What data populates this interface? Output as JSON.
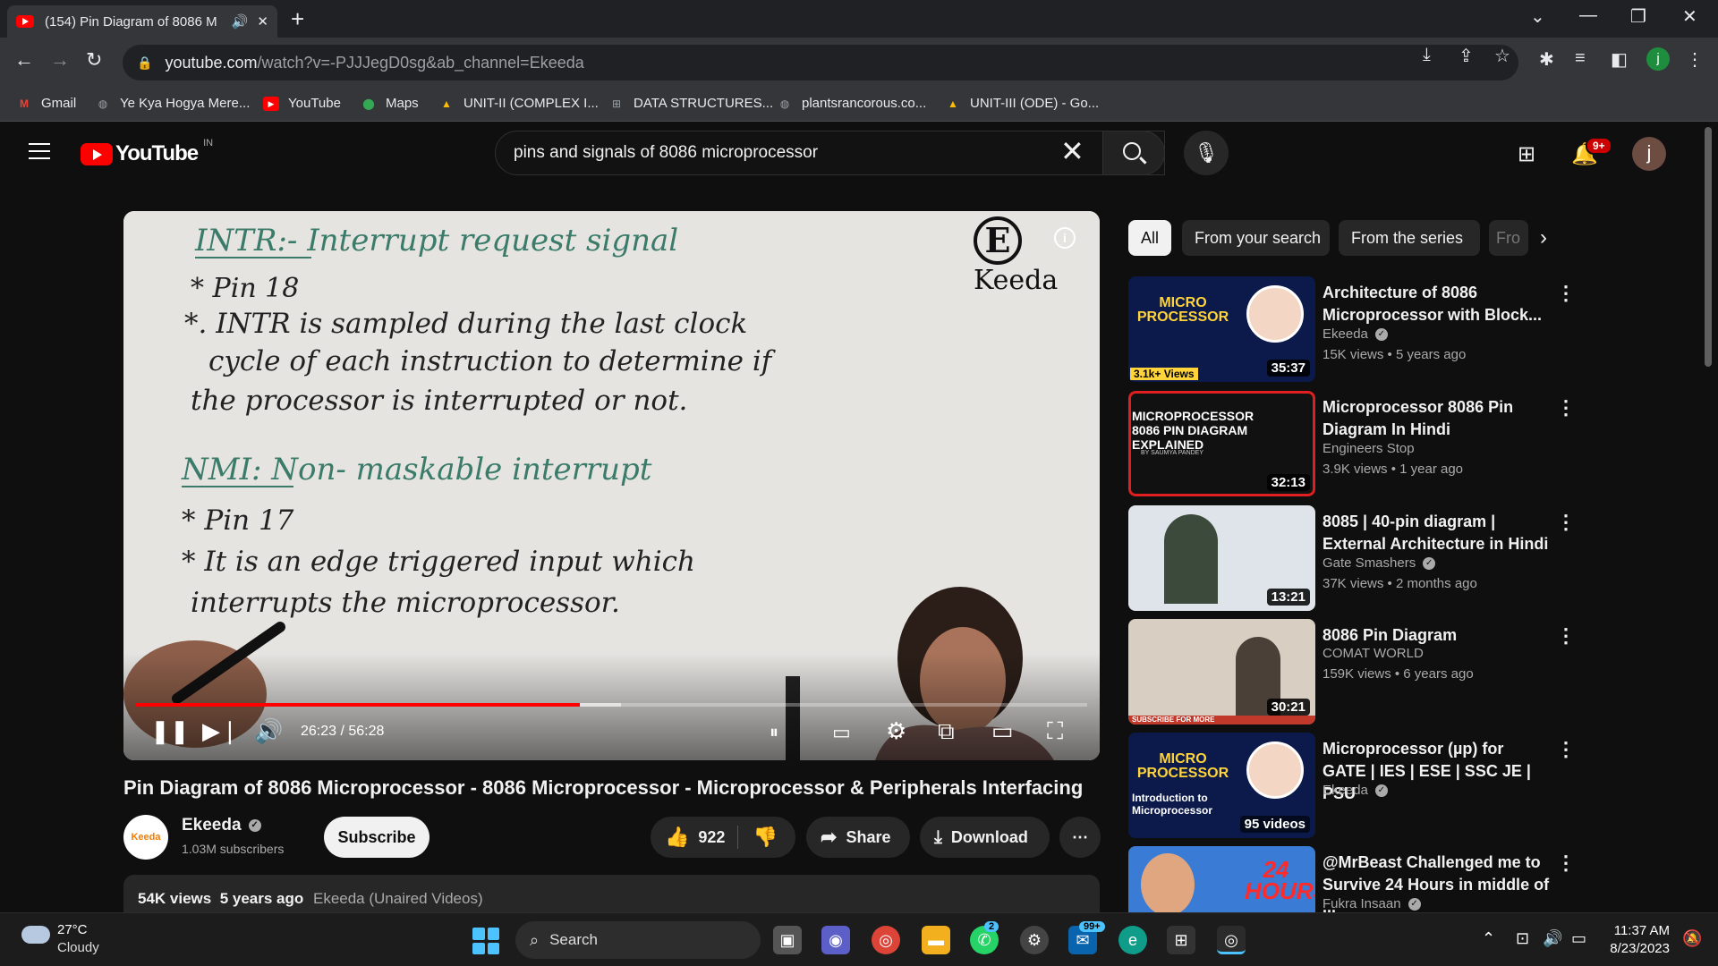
{
  "browser": {
    "tab_title": "(154) Pin Diagram of 8086 M",
    "url_domain": "youtube.com",
    "url_path": "/watch?v=-PJJJegD0sg&ab_channel=Ekeeda",
    "bookmarks": [
      {
        "label": "Gmail",
        "icon": "gmail-icon",
        "color": "#ea4335"
      },
      {
        "label": "Ye Kya Hogya Mere...",
        "icon": "globe-icon",
        "color": "#9aa0a6"
      },
      {
        "label": "YouTube",
        "icon": "youtube-icon",
        "color": "#ff0000"
      },
      {
        "label": "Maps",
        "icon": "maps-icon",
        "color": "#34a853"
      },
      {
        "label": "UNIT-II (COMPLEX I...",
        "icon": "drive-icon",
        "color": "#fbbc04"
      },
      {
        "label": "DATA STRUCTURES...",
        "icon": "cart-icon",
        "color": "#9aa0a6"
      },
      {
        "label": "plantsrancorous.co...",
        "icon": "globe-icon",
        "color": "#9aa0a6"
      },
      {
        "label": "UNIT-III (ODE) - Go...",
        "icon": "drive-icon",
        "color": "#fbbc04"
      }
    ]
  },
  "youtube": {
    "logo_text": "YouTube",
    "country_code": "IN",
    "search_query": "pins and signals of 8086 microprocessor",
    "notif_count": "9+",
    "avatar_letter": "j"
  },
  "player": {
    "board_lines": [
      "INTR:- Interrupt request signal",
      "* Pin 18",
      "*. INTR is sampled during the last clock",
      "cycle of each instruction to determine if",
      "the processor is interrupted or not.",
      "NMI: Non- maskable interrupt",
      "* Pin 17",
      "* It is an edge triggered input which",
      "interrupts the microprocessor."
    ],
    "watermark": "Keeda",
    "current_time": "26:23",
    "duration": "56:28",
    "time_display": "26:23 / 56:28",
    "progress_fraction": 0.467,
    "buffered_fraction": 0.51
  },
  "video": {
    "title": "Pin Diagram of 8086 Microprocessor - 8086 Microprocessor - Microprocessor & Peripherals Interfacing",
    "channel_name": "Ekeeda",
    "channel_avatar_text": "Keeda",
    "subscribers": "1.03M subscribers",
    "subscribe_label": "Subscribe",
    "likes": "922",
    "share_label": "Share",
    "download_label": "Download",
    "views": "54K views",
    "age": "5 years ago",
    "series": "Ekeeda (Unaired Videos)"
  },
  "chips": [
    "All",
    "From your search",
    "From the series",
    "Fro"
  ],
  "recommendations": [
    {
      "title": "Architecture of 8086 Microprocessor with Block...",
      "channel": "Ekeeda",
      "verified": true,
      "meta": "15K views  • 5 years ago",
      "duration": "35:37",
      "thumb_text": "MICRO PROCESSOR",
      "thumb_sub": "3.1k+ Views",
      "thumb_color": "#0b1a4a"
    },
    {
      "title": "Microprocessor 8086 Pin Diagram In Hindi",
      "channel": "Engineers Stop",
      "verified": false,
      "meta": "3.9K views  • 1 year ago",
      "duration": "32:13",
      "thumb_text": "MICROPROCESSOR 8086 PIN DIAGRAM EXPLAINED",
      "thumb_sub": "BY SAUMYA PANDEY",
      "thumb_color": "#111111"
    },
    {
      "title": "8085 | 40-pin diagram | External Architecture in Hindi",
      "channel": "Gate Smashers",
      "verified": true,
      "meta": "37K views  • 2 months ago",
      "duration": "13:21",
      "thumb_text": "",
      "thumb_sub": "",
      "thumb_color": "#dfe4ea"
    },
    {
      "title": "8086 Pin Diagram",
      "channel": "COMAT WORLD",
      "verified": false,
      "meta": "159K views  • 6 years ago",
      "duration": "30:21",
      "thumb_text": "",
      "thumb_sub": "SUBSCRIBE FOR MORE",
      "thumb_color": "#d8cfc2"
    },
    {
      "title": "Microprocessor (µp) for GATE | IES | ESE | SSC JE | PSU",
      "channel": "Ekeeda",
      "verified": true,
      "meta": "",
      "duration": "95 videos",
      "thumb_text": "MICRO PROCESSOR",
      "thumb_sub": "Introduction to Microprocessor",
      "thumb_color": "#0b1a4a"
    },
    {
      "title": "@MrBeast Challenged me to Survive 24 Hours in middle of ...",
      "channel": "Fukra Insaan",
      "verified": true,
      "meta": "",
      "duration": "",
      "thumb_text": "24 HOURS",
      "thumb_sub": "",
      "thumb_color": "#3a7bd5"
    }
  ],
  "taskbar": {
    "temperature": "27°C",
    "weather": "Cloudy",
    "search_label": "Search",
    "whatsapp_badge": "2",
    "mail_badge": "99+",
    "time": "11:37 AM",
    "date": "8/23/2023"
  },
  "colors": {
    "accent_red": "#ff0000",
    "bg": "#0f0f0f",
    "pill": "#272727"
  }
}
